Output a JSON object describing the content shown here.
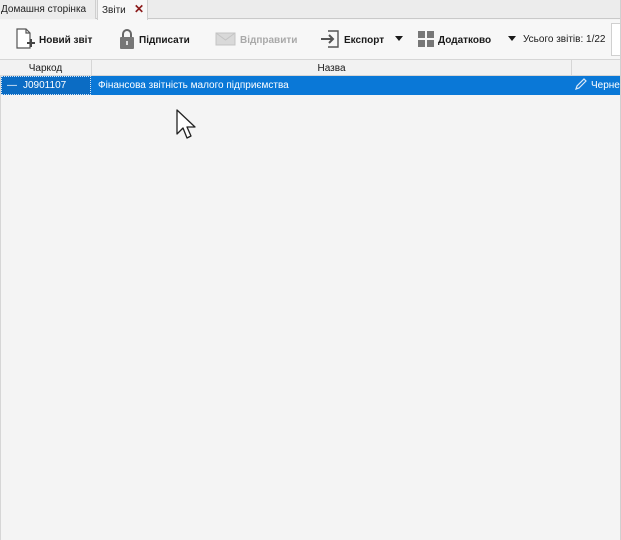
{
  "tabs": [
    {
      "label": "Домашня сторінка"
    },
    {
      "label": "Звіти"
    }
  ],
  "toolbar": {
    "new_report": "Новий звіт",
    "sign": "Підписати",
    "send": "Відправити",
    "export": "Експорт",
    "additional": "Додатково",
    "total_label": "Усього звітів: 1/22"
  },
  "grid": {
    "columns": [
      "Чаркод",
      "Назва",
      ""
    ],
    "rows": [
      {
        "barcode": "J0901107",
        "name": "Фінансова звітність малого підприємства",
        "status": "Черне"
      }
    ]
  },
  "colors": {
    "selection": "#0a78d7",
    "close_x": "#8b1a1a"
  },
  "icons": [
    "new-document-icon",
    "lock-icon",
    "envelope-icon",
    "export-icon",
    "grid-tiles-icon",
    "pen-icon",
    "close-icon",
    "mouse-cursor-icon"
  ]
}
